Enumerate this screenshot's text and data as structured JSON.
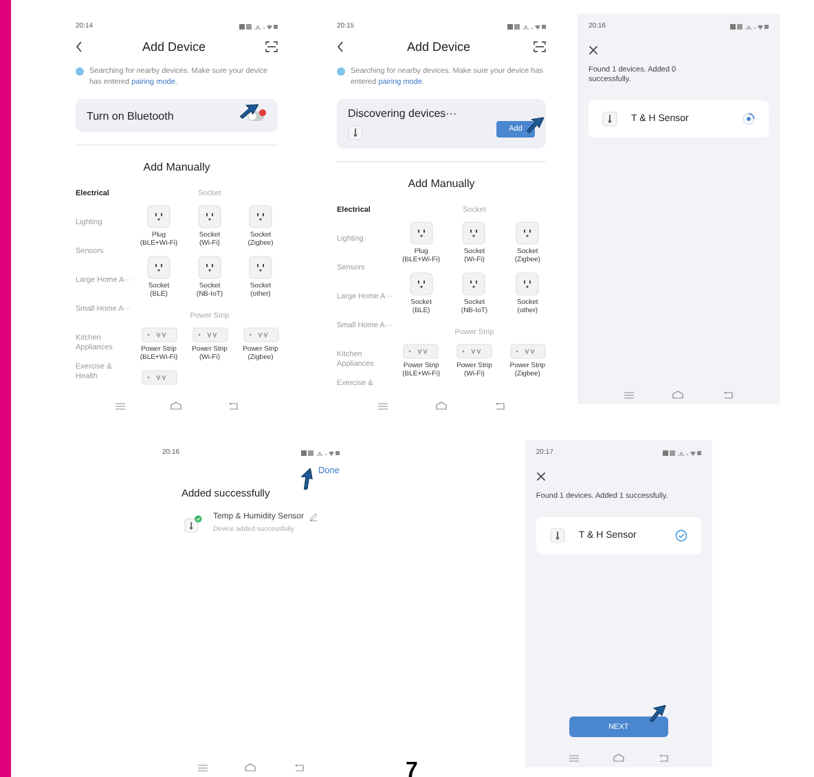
{
  "screens": [
    {
      "kind": "add_device",
      "time": "20:14",
      "title": "Add Device",
      "notice": "Searching for nearby devices. Make sure your device has entered ",
      "notice_link": "pairing mode",
      "notice_end": ".",
      "card": {
        "kind": "bluetooth",
        "label": "Turn on Bluetooth",
        "on": false
      },
      "section_title": "Add Manually",
      "categories": [
        {
          "label": "Electrical",
          "selected": true
        },
        {
          "label": "Lighting",
          "selected": false
        },
        {
          "label": "Sensors",
          "selected": false
        },
        {
          "label": "Large Home A···",
          "selected": false
        },
        {
          "label": "Small Home A···",
          "selected": false
        },
        {
          "label": "Kitchen Appliances",
          "selected": false
        },
        {
          "label": "Exercise & Health",
          "selected": false
        }
      ],
      "groups": [
        {
          "title": "Socket",
          "items": [
            {
              "kind": "socket",
              "label": "Plug\n(BLE+Wi-Fi)"
            },
            {
              "kind": "socket",
              "label": "Socket\n(Wi-Fi)"
            },
            {
              "kind": "socket",
              "label": "Socket\n(Zigbee)"
            },
            {
              "kind": "socket",
              "label": "Socket\n(BLE)"
            },
            {
              "kind": "socket",
              "label": "Socket\n(NB-IoT)"
            },
            {
              "kind": "socket",
              "label": "Socket\n(other)"
            }
          ]
        },
        {
          "title": "Power Strip",
          "items": [
            {
              "kind": "strip",
              "label": "Power Strip\n(BLE+Wi-Fi)"
            },
            {
              "kind": "strip",
              "label": "Power Strip\n(Wi-Fi)"
            },
            {
              "kind": "strip",
              "label": "Power Strip\n(Zigbee)"
            },
            {
              "kind": "strip"
            }
          ]
        }
      ]
    },
    {
      "kind": "add_device",
      "time": "20:15",
      "title": "Add Device",
      "notice": "Searching for nearby devices. Make sure your device has entered ",
      "notice_link": "pairing mode",
      "notice_end": ".",
      "card": {
        "kind": "discovering",
        "label": "Discovering devices···",
        "button": "Add"
      },
      "section_title": "Add Manually",
      "categories": [
        {
          "label": "Electrical",
          "selected": true
        },
        {
          "label": "Lighting",
          "selected": false
        },
        {
          "label": "Sensors",
          "selected": false
        },
        {
          "label": "Large Home A···",
          "selected": false
        },
        {
          "label": "Small Home A···",
          "selected": false
        },
        {
          "label": "Kitchen Appliances",
          "selected": false
        },
        {
          "label": "Exercise &",
          "selected": false
        }
      ],
      "groups": [
        {
          "title": "Socket",
          "items": [
            {
              "kind": "socket",
              "label": "Plug\n(BLE+Wi-Fi)"
            },
            {
              "kind": "socket",
              "label": "Socket\n(Wi-Fi)"
            },
            {
              "kind": "socket",
              "label": "Socket\n(Zigbee)"
            },
            {
              "kind": "socket",
              "label": "Socket\n(BLE)"
            },
            {
              "kind": "socket",
              "label": "Socket\n(NB-IoT)"
            },
            {
              "kind": "socket",
              "label": "Socket\n(other)"
            }
          ]
        },
        {
          "title": "Power Strip",
          "items": [
            {
              "kind": "strip",
              "label": "Power Strip\n(BLE+Wi-Fi)"
            },
            {
              "kind": "strip",
              "label": "Power Strip\n(Wi-Fi)"
            },
            {
              "kind": "strip",
              "label": "Power Strip\n(Zigbee)"
            }
          ]
        }
      ]
    },
    {
      "kind": "results",
      "time": "20:16",
      "summary": "Found 1 devices. Added 0\nsuccessfully.",
      "devices": [
        {
          "name": "T & H Sensor",
          "added": false
        }
      ]
    },
    {
      "kind": "success",
      "time": "20:16",
      "done": "Done",
      "title": "Added successfully",
      "device": {
        "name": "Temp & Humidity Sensor",
        "status": "Device added successfully"
      }
    },
    {
      "kind": "results",
      "time": "20:17",
      "summary": "Found 1 devices. Added 1 successfully.",
      "devices": [
        {
          "name": "T & H Sensor",
          "added": true
        }
      ],
      "button": "NEXT"
    }
  ],
  "page_number": "7"
}
